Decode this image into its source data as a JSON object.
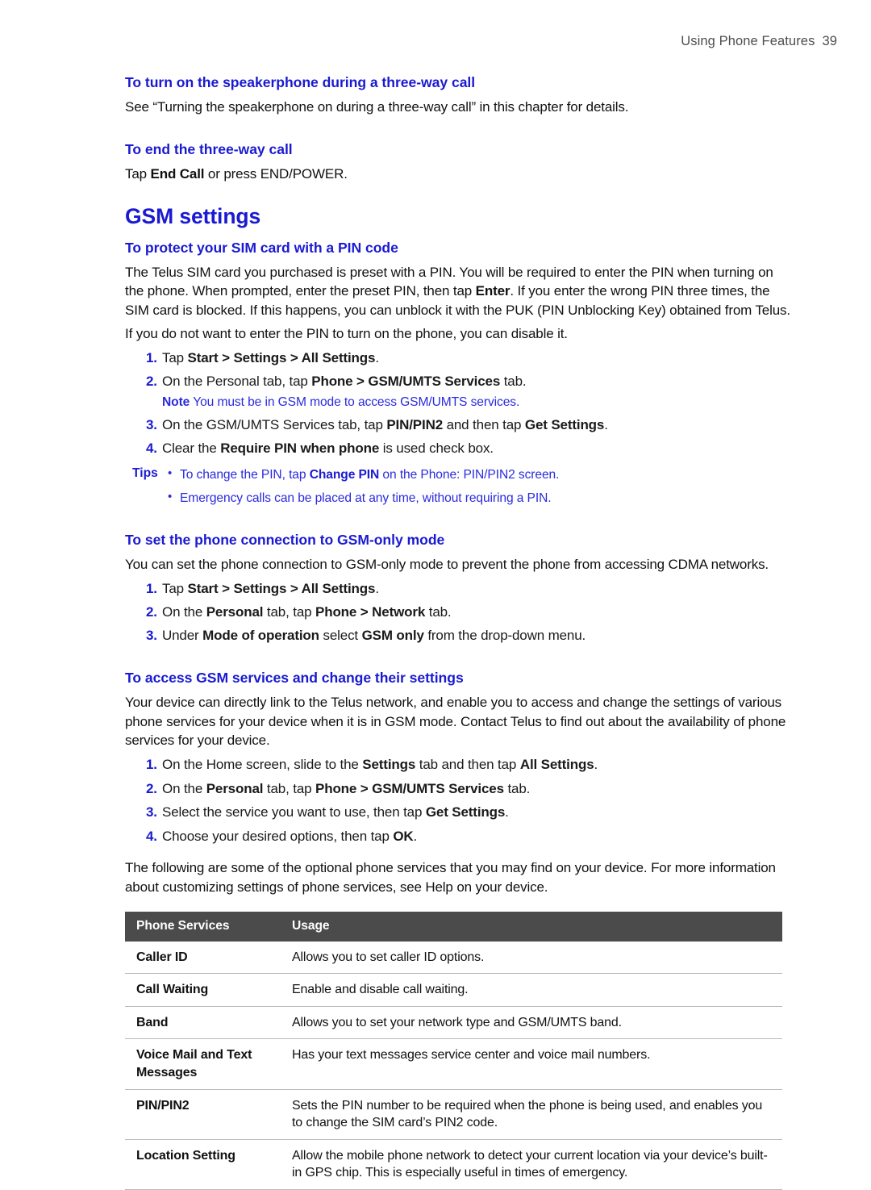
{
  "header": {
    "chapter_title": "Using Phone Features",
    "page_number": "39"
  },
  "colors": {
    "heading_blue": "#1a1ad2",
    "note_blue": "#2a2ae0",
    "table_header_bg": "#4b4b4b",
    "body_text": "#111111"
  },
  "sections": {
    "speakerphone": {
      "heading": "To turn on the speakerphone during a three-way call",
      "body": "See “Turning the speakerphone on during a three-way call” in this chapter for details."
    },
    "end_call": {
      "heading": "To end the three-way call",
      "body_prefix": "Tap ",
      "body_bold": "End Call",
      "body_suffix": " or press END/POWER."
    },
    "gsm_settings_title": "GSM settings",
    "sim_pin": {
      "heading": "To protect your SIM card with a PIN code",
      "para1": "The Telus SIM card you purchased is preset with a PIN. You will be required to enter the PIN when turning on the phone. When prompted, enter the preset PIN, then tap ",
      "para1_bold": "Enter",
      "para1_cont": ". If you enter the wrong PIN three times, the SIM card is blocked. If this happens, you can unblock it with the PUK (PIN Unblocking Key) obtained from Telus.",
      "para2": "If you do not want to enter the PIN to turn on the phone, you can disable it.",
      "steps": [
        {
          "num": "1.",
          "pre": "Tap ",
          "bold": "Start > Settings > All Settings",
          "post": "."
        },
        {
          "num": "2.",
          "pre": "On the Personal tab, tap ",
          "bold": "Phone > GSM/UMTS Services",
          "post": " tab.",
          "note_label": "Note",
          "note_text": "You must be in GSM mode to access GSM/UMTS services."
        },
        {
          "num": "3.",
          "pre": "On the GSM/UMTS Services tab, tap ",
          "bold": "PIN/PIN2",
          "mid": " and then tap ",
          "bold2": "Get Settings",
          "post": "."
        },
        {
          "num": "4.",
          "pre": "Clear the ",
          "bold": "Require PIN when phone",
          "post": " is used check box."
        }
      ],
      "tips_label": "Tips",
      "tips": [
        {
          "pre": "To change the PIN, tap ",
          "bold": "Change PIN",
          "post": " on the Phone: PIN/PIN2 screen."
        },
        {
          "pre": "Emergency calls can be placed at any time, without requiring a PIN.",
          "bold": "",
          "post": ""
        }
      ]
    },
    "gsm_only": {
      "heading": "To set the phone connection to GSM-only mode",
      "body": "You can set the phone connection to GSM-only mode to prevent the phone from accessing CDMA networks.",
      "steps": [
        {
          "num": "1.",
          "pre": "Tap ",
          "bold": "Start > Settings > All Settings",
          "post": "."
        },
        {
          "num": "2.",
          "pre": "On the ",
          "bold": "Personal",
          "mid": " tab, tap ",
          "bold2": "Phone > Network",
          "post": " tab."
        },
        {
          "num": "3.",
          "pre": "Under ",
          "bold": "Mode of operation",
          "mid": " select ",
          "bold2": "GSM only",
          "post": " from the drop-down menu."
        }
      ]
    },
    "gsm_services": {
      "heading": "To access GSM services and change their settings",
      "body": "Your device can directly link to the Telus network, and enable you to access and change the settings of various phone services for your device when it is in GSM mode. Contact Telus to find out about the availability of phone services for your device.",
      "steps": [
        {
          "num": "1.",
          "pre": "On the Home screen, slide to the ",
          "bold": "Settings",
          "mid": " tab and then tap ",
          "bold2": "All Settings",
          "post": "."
        },
        {
          "num": "2.",
          "pre": "On the ",
          "bold": "Personal",
          "mid": " tab, tap ",
          "bold2": "Phone > GSM/UMTS Services",
          "post": " tab."
        },
        {
          "num": "3.",
          "pre": "Select the service you want to use, then tap ",
          "bold": "Get Settings",
          "post": "."
        },
        {
          "num": "4.",
          "pre": "Choose your desired options, then tap ",
          "bold": "OK",
          "post": "."
        }
      ],
      "closing_para": "The following are some of the optional phone services that you may find on your device. For more information about customizing settings of phone services, see Help on your device."
    }
  },
  "services_table": {
    "columns": [
      "Phone Services",
      "Usage"
    ],
    "rows": [
      {
        "service": "Caller ID",
        "usage": "Allows you to set caller ID options."
      },
      {
        "service": "Call Waiting",
        "usage": "Enable and disable call waiting."
      },
      {
        "service": "Band",
        "usage": "Allows you to set your network type and GSM/UMTS band."
      },
      {
        "service": "Voice Mail and Text Messages",
        "usage": "Has your text messages service center and voice mail numbers."
      },
      {
        "service": "PIN/PIN2",
        "usage": "Sets the PIN number to be required when the phone is being used, and enables you to change the SIM card’s PIN2 code."
      },
      {
        "service": "Location Setting",
        "usage": "Allow the mobile phone network to detect your current location via your device’s built-in GPS chip. This is especially useful in times of emergency."
      }
    ]
  }
}
